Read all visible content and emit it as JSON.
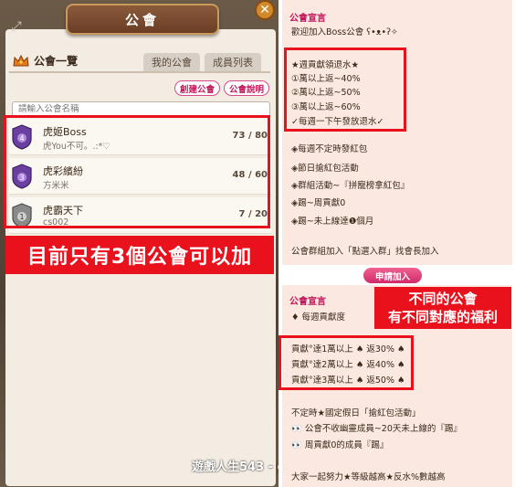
{
  "left": {
    "title": "公會",
    "close_glyph": "✕",
    "expand_glyph": "⤢",
    "list_title": "公會一覽",
    "tabs": [
      "我的公會",
      "成員列表"
    ],
    "buttons": {
      "create": "創建公會",
      "explain": "公會說明"
    },
    "search_placeholder": "請輸入公會名稱",
    "guilds": [
      {
        "name": "虎姬Boss",
        "sub": "虎You不可。.:*♡",
        "count": "73 / 80",
        "rank": "4",
        "color": "#6b3fa0"
      },
      {
        "name": "虎彩繽紛",
        "sub": "方米米",
        "count": "48 / 60",
        "rank": "3",
        "color": "#6b3fa0"
      },
      {
        "name": "虎霸天下",
        "sub": "cs002",
        "count": "7 / 20",
        "rank": "1",
        "color": "#8a8a8a"
      }
    ],
    "caption": "目前只有3個公會可以加",
    "watermark": "遊戲人生543 - gamelife.com"
  },
  "right": {
    "card1": {
      "title": "公會宣言",
      "lines": [
        "歡迎加入Boss公會 ʕ•ᴥ•ʔ✧",
        "★週貢獻領退水★",
        "①萬以上返~40%",
        "②萬以上返~50%",
        "③萬以上返~60%",
        "✓每週一下午發放退水✓",
        "◈每週不定時發紅包",
        "◈節日搶紅包活動",
        "◈群組活動~『拼寵榜拿紅包』",
        "◈踢~周貢獻0",
        "◈踢~未上線達❶個月",
        "公會群組加入「點選入群」找會長加入"
      ]
    },
    "apply_button": "申請加入",
    "card2": {
      "title": "公會宣言",
      "lines": [
        "♦ 每週貢獻度",
        "貢獻°達1萬以上 ♠ 返30% ♠",
        "貢獻°達2萬以上 ♠ 返40% ♠",
        "貢獻°達3萬以上 ♠ 返50% ♠",
        "不定時★國定假日「搶紅包活動」",
        "👀 公會不收幽靈成員~20天未上線的『踢』",
        "👀 周貢獻0的成員『踢』",
        "大家一起努力★等級越高★反水%數越高"
      ]
    },
    "annotation": [
      "不同的公會",
      "有不同對應的福利"
    ]
  },
  "colors": {
    "highlight_red": "#e8111c",
    "accent_pink": "#c2185b"
  }
}
